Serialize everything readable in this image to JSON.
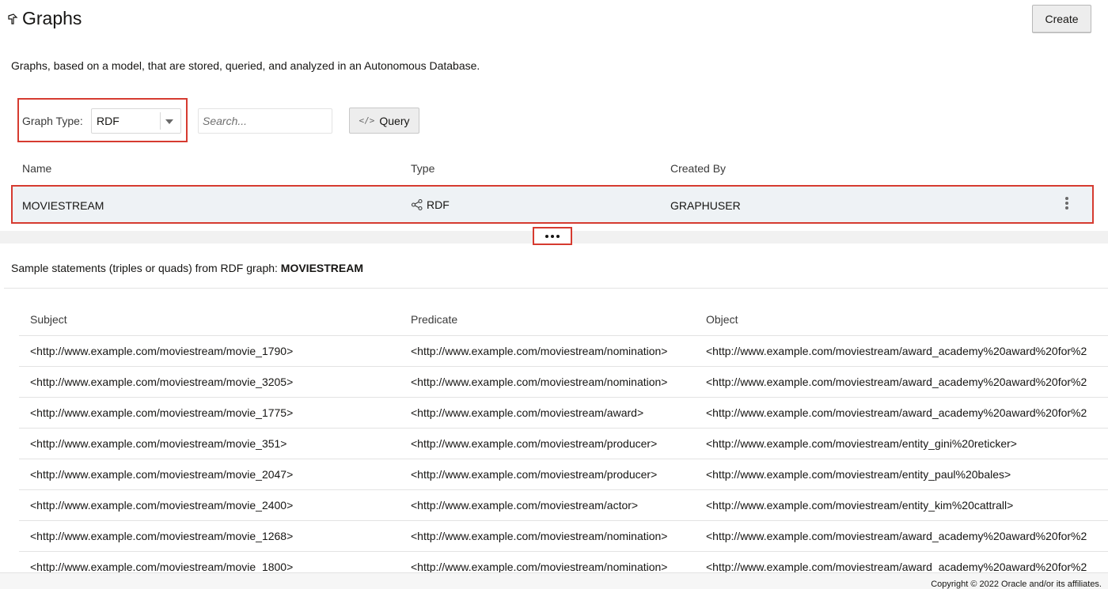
{
  "header": {
    "title": "Graphs",
    "create_label": "Create"
  },
  "description": "Graphs, based on a model, that are stored, queried, and analyzed in an Autonomous Database.",
  "filters": {
    "graph_type_label": "Graph Type:",
    "graph_type_value": "RDF",
    "search_placeholder": "Search...",
    "query_label": "Query"
  },
  "graphs_table": {
    "columns": [
      "Name",
      "Type",
      "Created By"
    ],
    "rows": [
      {
        "name": "MOVIESTREAM",
        "type": "RDF",
        "created_by": "GRAPHUSER"
      }
    ]
  },
  "sample": {
    "title_prefix": "Sample statements (triples or quads) from RDF graph:",
    "graph_name": "MOVIESTREAM",
    "columns": [
      "Subject",
      "Predicate",
      "Object"
    ],
    "rows": [
      [
        "<http://www.example.com/moviestream/movie_1790>",
        "<http://www.example.com/moviestream/nomination>",
        "<http://www.example.com/moviestream/award_academy%20award%20for%2"
      ],
      [
        "<http://www.example.com/moviestream/movie_3205>",
        "<http://www.example.com/moviestream/nomination>",
        "<http://www.example.com/moviestream/award_academy%20award%20for%2"
      ],
      [
        "<http://www.example.com/moviestream/movie_1775>",
        "<http://www.example.com/moviestream/award>",
        "<http://www.example.com/moviestream/award_academy%20award%20for%2"
      ],
      [
        "<http://www.example.com/moviestream/movie_351>",
        "<http://www.example.com/moviestream/producer>",
        "<http://www.example.com/moviestream/entity_gini%20reticker>"
      ],
      [
        "<http://www.example.com/moviestream/movie_2047>",
        "<http://www.example.com/moviestream/producer>",
        "<http://www.example.com/moviestream/entity_paul%20bales>"
      ],
      [
        "<http://www.example.com/moviestream/movie_2400>",
        "<http://www.example.com/moviestream/actor>",
        "<http://www.example.com/moviestream/entity_kim%20cattrall>"
      ],
      [
        "<http://www.example.com/moviestream/movie_1268>",
        "<http://www.example.com/moviestream/nomination>",
        "<http://www.example.com/moviestream/award_academy%20award%20for%2"
      ],
      [
        "<http://www.example.com/moviestream/movie_1800>",
        "<http://www.example.com/moviestream/nomination>",
        "<http://www.example.com/moviestream/award_academy%20award%20for%2"
      ]
    ]
  },
  "footer": {
    "copyright": "Copyright © 2022 Oracle and/or its affiliates."
  },
  "colors": {
    "highlight_border": "#d63b30",
    "selected_row_bg": "#eef2f5"
  }
}
